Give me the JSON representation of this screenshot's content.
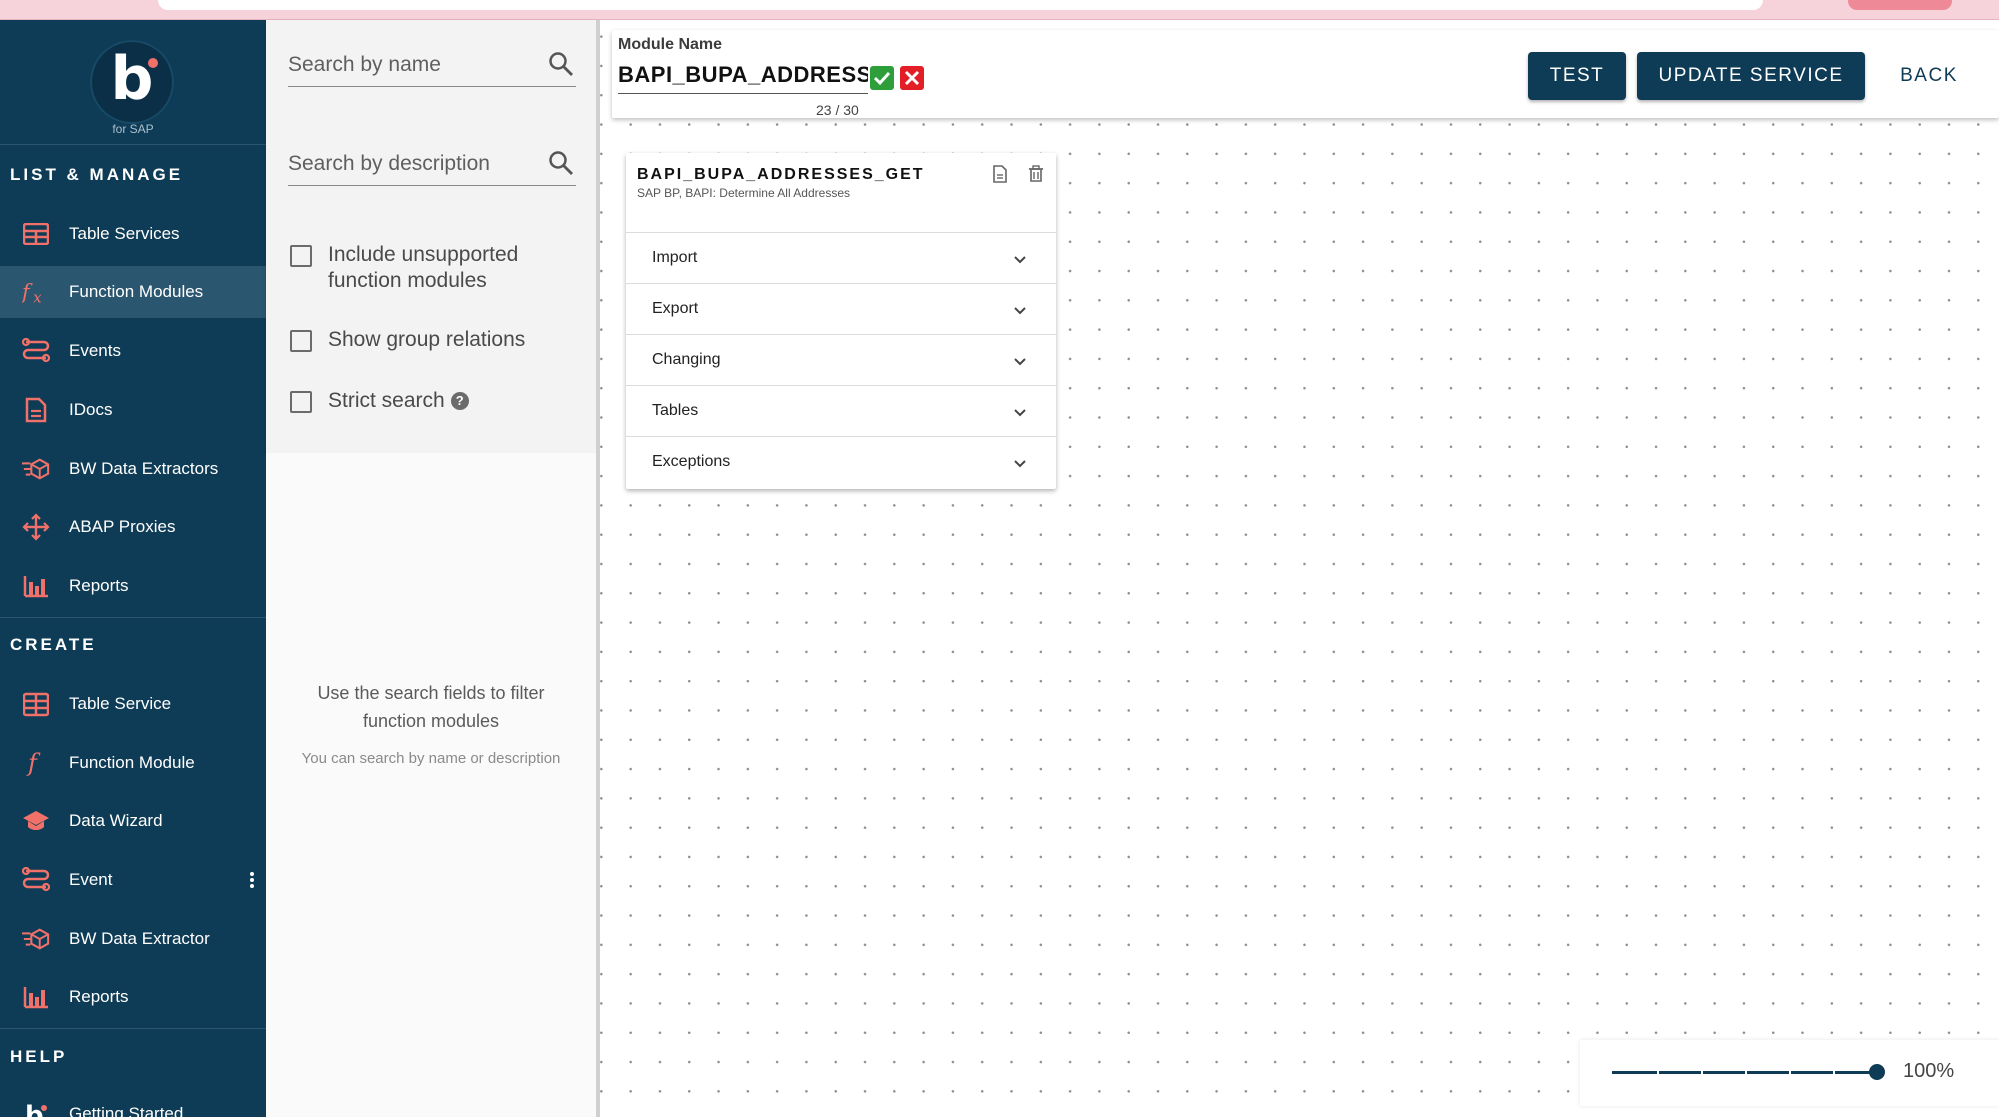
{
  "sidebar": {
    "logo_letter": "b",
    "logo_sub": "for SAP",
    "list_manage_title": "LIST & MANAGE",
    "list_manage": [
      {
        "label": "Table Services",
        "icon": "table-icon"
      },
      {
        "label": "Function Modules",
        "icon": "function-fx-icon",
        "active": true
      },
      {
        "label": "Events",
        "icon": "events-icon"
      },
      {
        "label": "IDocs",
        "icon": "document-icon"
      },
      {
        "label": "BW Data Extractors",
        "icon": "cube-extract-icon"
      },
      {
        "label": "ABAP Proxies",
        "icon": "proxy-arrows-icon"
      },
      {
        "label": "Reports",
        "icon": "bar-chart-icon"
      }
    ],
    "create_title": "CREATE",
    "create": [
      {
        "label": "Table Service",
        "icon": "table-add-icon"
      },
      {
        "label": "Function Module",
        "icon": "function-f-icon"
      },
      {
        "label": "Data Wizard",
        "icon": "graduation-cap-icon"
      },
      {
        "label": "Event",
        "icon": "events-icon"
      },
      {
        "label": "BW Data Extractor",
        "icon": "cube-extract-icon"
      },
      {
        "label": "Reports",
        "icon": "bar-chart-icon"
      }
    ],
    "help_title": "HELP",
    "help": [
      {
        "label": "Getting Started",
        "icon": "b-logo-icon"
      }
    ]
  },
  "filter": {
    "search_name_placeholder": "Search by name",
    "search_desc_placeholder": "Search by description",
    "include_unsupported": "Include unsupported function modules",
    "show_group_relations": "Show group relations",
    "strict_search": "Strict search",
    "empty_title": "Use the search fields to filter function modules",
    "empty_sub": "You can search by name or description"
  },
  "header": {
    "module_name_label": "Module Name",
    "module_name_value": "BAPI_BUPA_ADDRESSES_GET",
    "char_count": "23 / 30",
    "test_label": "TEST",
    "update_label": "UPDATE SERVICE",
    "back_label": "BACK"
  },
  "function_card": {
    "title": "BAPI_BUPA_ADDRESSES_GET",
    "subtitle": "SAP BP, BAPI: Determine All Addresses",
    "sections": [
      "Import",
      "Export",
      "Changing",
      "Tables",
      "Exceptions"
    ]
  },
  "zoom": {
    "label": "100%",
    "level": 1.0
  },
  "colors": {
    "sidebar_bg": "#0e3b55",
    "accent_icon": "#f0716a",
    "primary_button": "#0e3b55"
  }
}
